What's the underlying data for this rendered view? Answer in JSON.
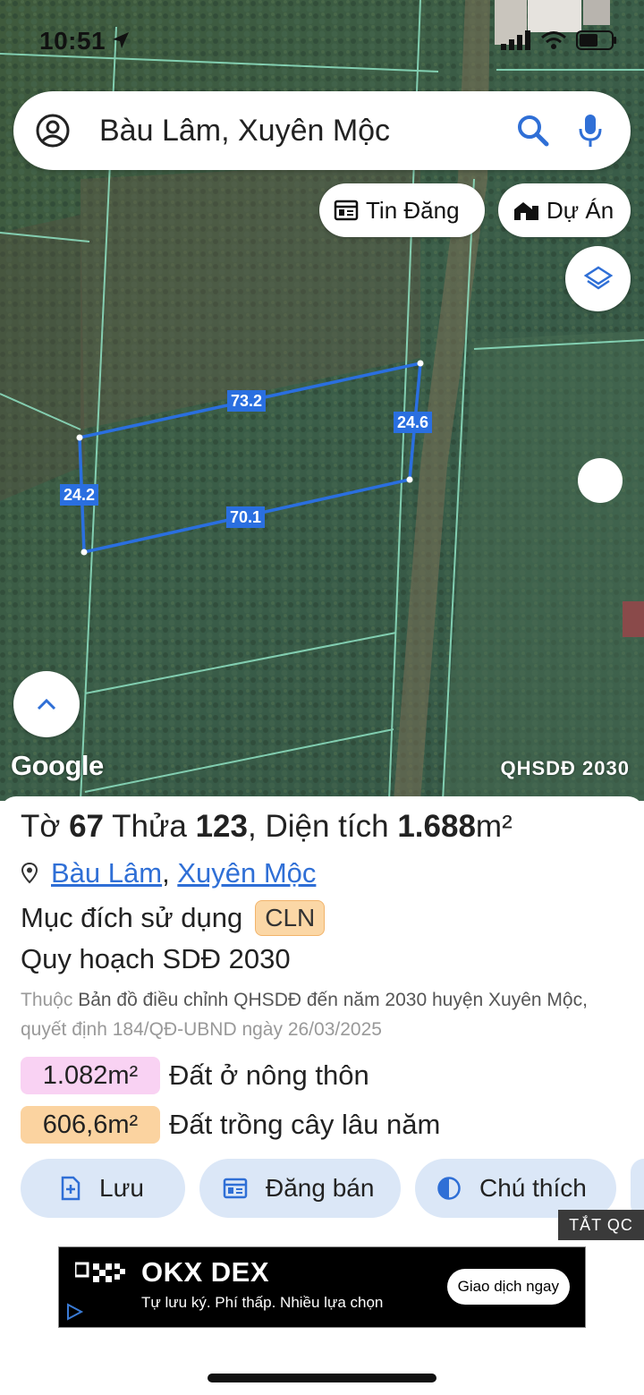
{
  "status_bar": {
    "time": "10:51"
  },
  "search": {
    "query": "Bàu Lâm, Xuyên Mộc"
  },
  "chips": {
    "listings": "Tin Đăng",
    "projects": "Dự Án"
  },
  "map": {
    "brand": "Google",
    "overlay_label": "QHSDĐ 2030",
    "edge_lengths": {
      "top": "73.2",
      "right": "24.6",
      "bottom": "70.1",
      "left": "24.2"
    }
  },
  "parcel": {
    "sheet_label": "Tờ",
    "sheet_no": "67",
    "lot_label": "Thửa",
    "lot_no": "123",
    "area_label": "Diện tích",
    "area_value": "1.688",
    "area_unit": "m²",
    "commune": "Bàu Lâm",
    "district": "Xuyên Mộc",
    "purpose_label": "Mục đích sử dụng",
    "purpose_code": "CLN",
    "plan_title": "Quy hoạch SDĐ 2030",
    "source_prefix": "Thuộc",
    "source_map": "Bản đồ điều chỉnh QHSDĐ đến năm 2030 huyện Xuyên Mộc",
    "source_decision": "quyết định 184/QĐ-UBND ngày 26/03/2025",
    "land_uses": [
      {
        "area": "1.082m²",
        "type": "Đất ở nông thôn",
        "color": "#f9d2f3"
      },
      {
        "area": "606,6m²",
        "type": "Đất trồng cây lâu năm",
        "color": "#fbd3a0"
      }
    ]
  },
  "actions": {
    "save": "Lưu",
    "post": "Đăng bán",
    "legend": "Chú thích"
  },
  "ad": {
    "hide_label": "TẮT QC",
    "brand": "OKX DEX",
    "tagline": "Tự lưu ký. Phí thấp. Nhiều lựa chọn",
    "cta": "Giao dịch ngay"
  },
  "colors": {
    "parcel_outline": "#2a6fe0",
    "link": "#2f6fd6",
    "action_bg": "#dbe7f7",
    "map_lines": "#8fe3c4"
  }
}
